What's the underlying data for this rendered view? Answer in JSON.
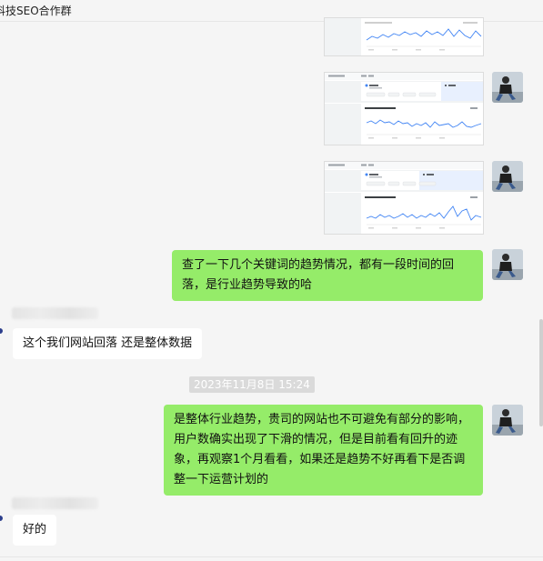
{
  "window": {
    "title": "科技SEO合作群"
  },
  "messages": {
    "m4_text": "查了一下几个关键词的趋势情况，都有一段时间的回落，是行业趋势导致的哈",
    "m5_text": "这个我们网站回落 还是整体数据",
    "timestamp": "2023年11月8日 15:24",
    "m6_text": "是整体行业趋势，贵司的网站也不可避免有部分的影响，用户数确实出现了下滑的情况，但是目前看有回升的迹象，再观察1个月看看，如果还是趋势不好再看下是否调整一下运营计划的",
    "m7_text": "好的"
  },
  "colors": {
    "own_bubble": "#95ec69",
    "other_bubble": "#ffffff",
    "background": "#f5f5f5",
    "trend_line": "#4285f4",
    "timestamp_bg": "#dadada"
  }
}
